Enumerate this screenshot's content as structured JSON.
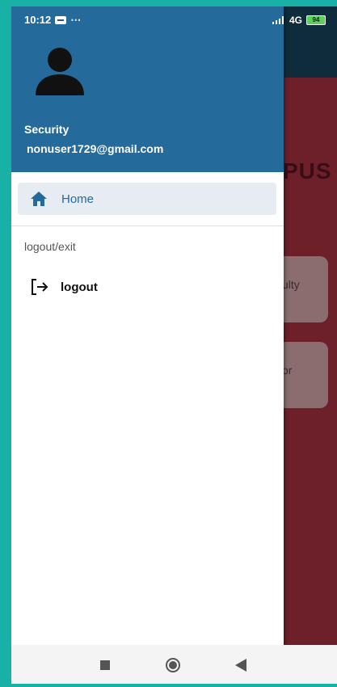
{
  "status_bar": {
    "time": "10:12",
    "more": "⋯",
    "signal": "4G",
    "battery": "94"
  },
  "background_app": {
    "title_fragment": "PUS",
    "card1_fragment": "culty",
    "card2_fragment": "itor"
  },
  "drawer": {
    "user": {
      "role": "Security",
      "email": "nonuser1729@gmail.com"
    },
    "items": [
      {
        "label": "Home",
        "icon": "home-icon",
        "selected": true
      }
    ],
    "section": {
      "label": "logout/exit",
      "items": [
        {
          "label": "logout",
          "icon": "logout-icon"
        }
      ]
    }
  },
  "colors": {
    "header": "#246a9b",
    "selected_bg": "#e6ecf1",
    "accent": "#246a9b",
    "background_app": "#6d1f2a"
  },
  "nav_bar": {
    "buttons": [
      "recents",
      "home",
      "back"
    ]
  }
}
